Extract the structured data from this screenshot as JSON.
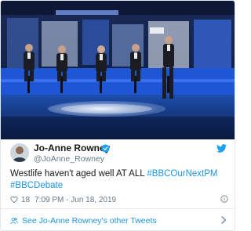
{
  "media": {
    "description_icon": "debate-studio-photo"
  },
  "author": {
    "name": "Jo-Anne Rowney",
    "handle": "@JoAnne_Rowney",
    "verified": true,
    "avatar_icon": "user-avatar"
  },
  "tweet": {
    "text_before": "Westlife haven't aged well AT ALL ",
    "hashtag_1": "#BBCOurNextPM",
    "hashtag_2": "#BBCDebate"
  },
  "meta": {
    "likes": "18",
    "timestamp": "7:09 PM - Jun 18, 2019"
  },
  "footer": {
    "more_link": "See Jo-Anne Rowney's other Tweets"
  },
  "colors": {
    "link": "#1b95e0",
    "muted": "#657786",
    "text": "#14171a",
    "twitter_blue": "#1da1f2"
  }
}
